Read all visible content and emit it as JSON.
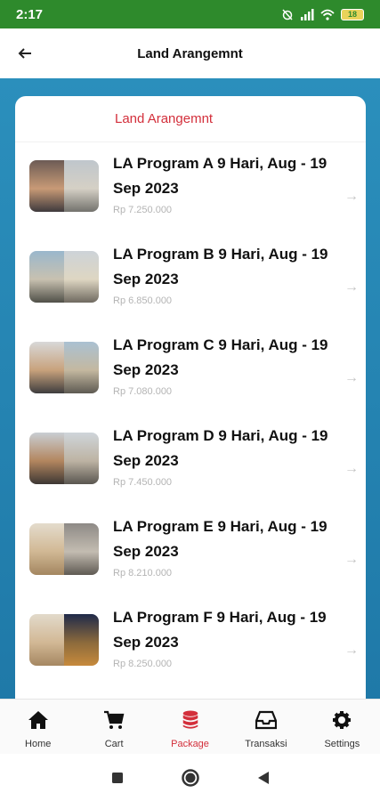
{
  "status": {
    "time": "2:17",
    "battery": "18"
  },
  "header": {
    "title": "Land Arangemnt"
  },
  "card": {
    "title": "Land Arangemnt"
  },
  "packages": [
    {
      "name": "LA Program A 9 Hari, Aug - 19 Sep 2023",
      "price": "Rp 7.250.000"
    },
    {
      "name": "LA Program B 9 Hari, Aug - 19 Sep 2023",
      "price": "Rp 6.850.000"
    },
    {
      "name": "LA Program C 9 Hari, Aug - 19 Sep 2023",
      "price": "Rp 7.080.000"
    },
    {
      "name": "LA Program D 9 Hari, Aug - 19 Sep 2023",
      "price": "Rp 7.450.000"
    },
    {
      "name": "LA Program E 9 Hari, Aug - 19 Sep 2023",
      "price": "Rp 8.210.000"
    },
    {
      "name": "LA Program F 9 Hari, Aug - 19 Sep 2023",
      "price": "Rp 8.250.000"
    }
  ],
  "nav": {
    "home": "Home",
    "cart": "Cart",
    "package": "Package",
    "transaksi": "Transaksi",
    "settings": "Settings"
  },
  "colors": {
    "accent": "#d32f3b",
    "status_bar": "#2e8a2c",
    "background": "#2b8fbc"
  }
}
